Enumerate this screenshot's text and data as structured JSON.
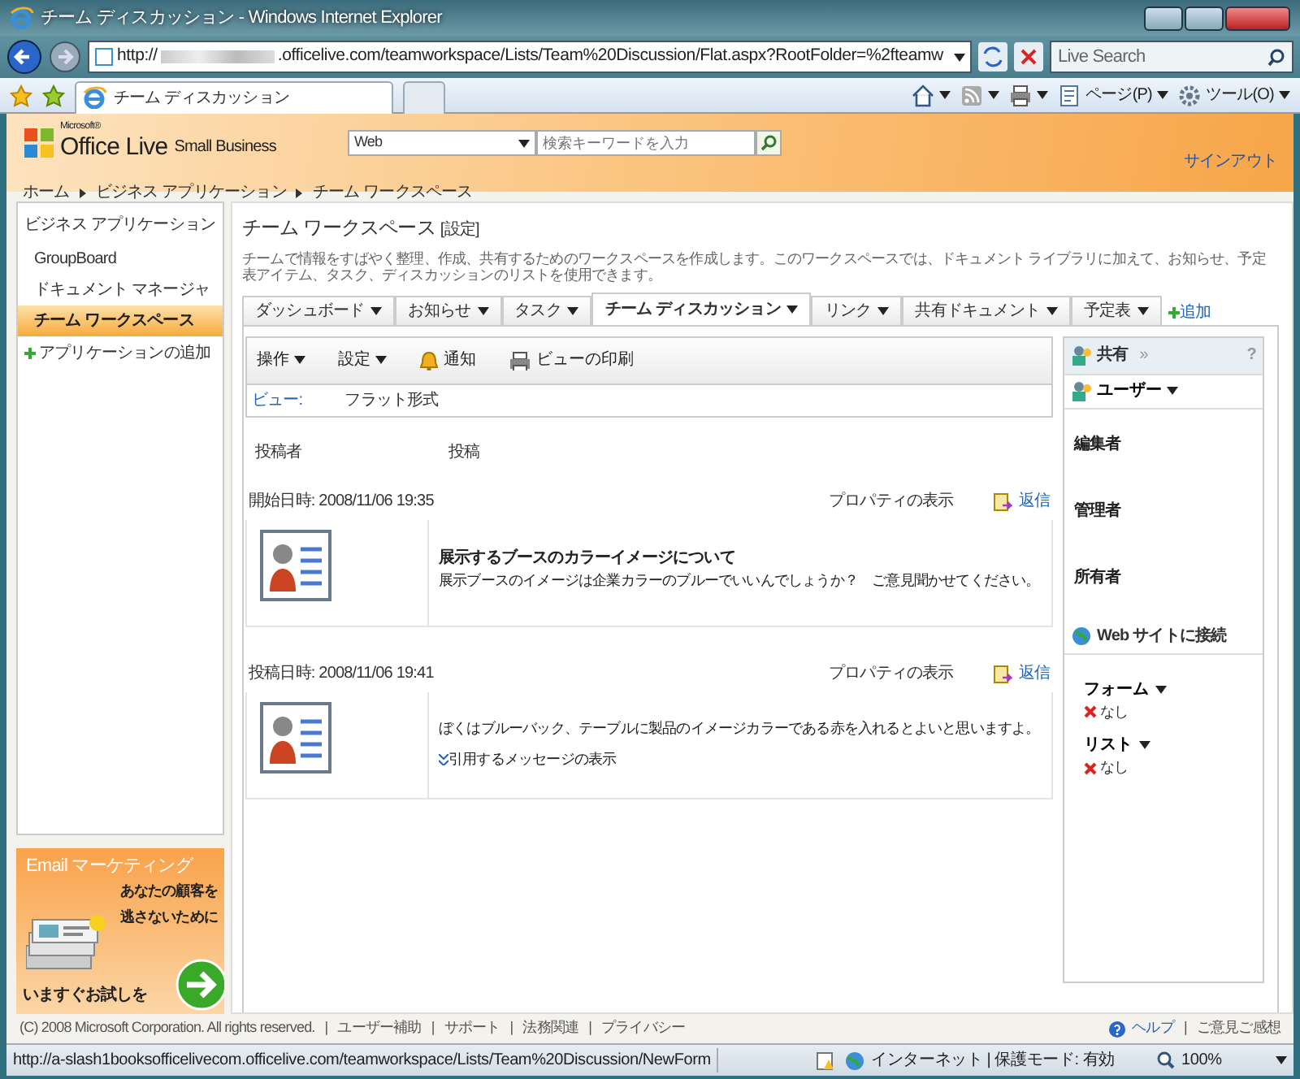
{
  "window": {
    "title": "チーム ディスカッション - Windows Internet Explorer"
  },
  "address_bar": {
    "url_start": "http://",
    "url_end": ".officelive.com/teamworkspace/Lists/Team%20Discussion/Flat.aspx?RootFolder=%2fteamw",
    "search_placeholder": "Live Search"
  },
  "browser_tabs": [
    {
      "label": "チーム ディスカッション",
      "selected": true
    }
  ],
  "command_bar": [
    {
      "kind": "home"
    },
    {
      "kind": "feeds"
    },
    {
      "kind": "print"
    },
    {
      "kind": "page",
      "label": "ページ(P)"
    },
    {
      "kind": "tools",
      "label": "ツール(O)"
    }
  ],
  "header": {
    "logo_small": "Microsoft®",
    "logo": "Office Live",
    "logo_sub": "Small Business",
    "search_scope": "Web",
    "search_placeholder": "検索キーワードを入力",
    "sign_out": "サインアウト"
  },
  "breadcrumb": [
    "ホーム",
    "ビジネス アプリケーション",
    "チーム ワークスペース"
  ],
  "sidebar": {
    "heading": "ビジネス アプリケーション",
    "items": [
      {
        "label": "GroupBoard",
        "selected": false
      },
      {
        "label": "ドキュメント マネージャ",
        "selected": false
      },
      {
        "label": "チーム ワークスペース",
        "selected": true
      }
    ],
    "add": "アプリケーションの追加"
  },
  "ad": {
    "title": "Email マーケティング",
    "line1": "あなたの顧客を",
    "line2": "逃さないために",
    "cta": "いますぐお試しを"
  },
  "page": {
    "title": "チーム ワークスペース",
    "settings_link": "[設定]",
    "description": "チームで情報をすばやく整理、作成、共有するためのワークスペースを作成します。このワークスペースでは、ドキュメント ライブラリに加えて、お知らせ、予定表アイテム、タスク、ディスカッションのリストを使用できます。"
  },
  "tabs": [
    {
      "label": "ダッシュボード",
      "selected": false
    },
    {
      "label": "お知らせ",
      "selected": false
    },
    {
      "label": "タスク",
      "selected": false
    },
    {
      "label": "チーム ディスカッション",
      "selected": true
    },
    {
      "label": "リンク",
      "selected": false
    },
    {
      "label": "共有ドキュメント",
      "selected": false
    },
    {
      "label": "予定表",
      "selected": false
    }
  ],
  "add_tab": "追加",
  "toolbar": [
    {
      "kind": "menu",
      "label": "操作"
    },
    {
      "kind": "menu",
      "label": "設定"
    },
    {
      "kind": "alert",
      "label": "通知"
    },
    {
      "kind": "print",
      "label": "ビューの印刷"
    }
  ],
  "view": {
    "label": "ビュー:",
    "value": "フラット形式"
  },
  "columns": [
    "投稿者",
    "投稿"
  ],
  "posts": [
    {
      "date": "開始日時: 2008/11/06 19:35",
      "properties": "プロパティの表示",
      "reply": "返信",
      "subject": "展示するブースのカラーイメージについて",
      "body": "展示ブースのイメージは企業カラーのブルーでいいんでしょうか？　ご意見聞かせてください。"
    },
    {
      "date": "投稿日時: 2008/11/06 19:41",
      "properties": "プロパティの表示",
      "reply": "返信",
      "body": "ぼくはブルーバック、テーブルに製品のイメージカラーである赤を入れるとよいと思いますよ。",
      "quote_link": "引用するメッセージの表示"
    }
  ],
  "side_panel": {
    "title": "共有",
    "expand": "»",
    "help": "?",
    "users_menu": "ユーザー",
    "roles": [
      "編集者",
      "管理者",
      "所有者"
    ],
    "connect": "Web サイトに接続",
    "lists": [
      {
        "label": "フォーム",
        "value": "なし"
      },
      {
        "label": "リスト",
        "value": "なし"
      }
    ]
  },
  "footer": {
    "divider": "|",
    "copyright": "(C) 2008 Microsoft Corporation. All rights reserved.",
    "links": [
      "ユーザー補助",
      "サポート",
      "法務関連",
      "プライバシー"
    ],
    "help": "ヘルプ",
    "feedback": "ご意見ご感想"
  },
  "status_bar": {
    "url": "http://a-slash1booksofficelivecom.officelive.com/teamworkspace/Lists/Team%20Discussion/NewForm",
    "zone": "インターネット | 保護モード: 有効",
    "zoom": "100%"
  }
}
